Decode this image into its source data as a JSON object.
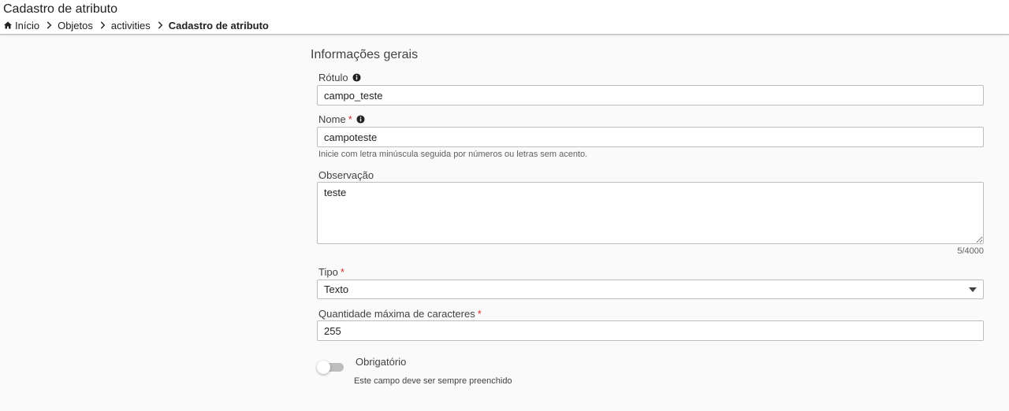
{
  "header": {
    "title": "Cadastro de atributo",
    "breadcrumb": [
      {
        "label": "Início",
        "icon": "home-icon"
      },
      {
        "label": "Objetos"
      },
      {
        "label": "activities"
      },
      {
        "label": "Cadastro de atributo"
      }
    ]
  },
  "form": {
    "section_title": "Informações gerais",
    "rotulo": {
      "label": "Rótulo",
      "value": "campo_teste"
    },
    "nome": {
      "label": "Nome",
      "required_mark": "*",
      "value": "campoteste",
      "hint": "Inicie com letra minúscula seguida por números ou letras sem acento."
    },
    "observacao": {
      "label": "Observação",
      "value": "teste",
      "counter": "5/4000"
    },
    "tipo": {
      "label": "Tipo",
      "required_mark": "*",
      "value": "Texto"
    },
    "quantidade": {
      "label": "Quantidade máxima de caracteres",
      "required_mark": "*",
      "value": "255"
    },
    "obrigatorio": {
      "label": "Obrigatório",
      "hint": "Este campo deve ser sempre preenchido",
      "checked": false
    }
  },
  "colors": {
    "required": "#d32f2f",
    "border": "#bdbdbd",
    "background": "#fafafa"
  }
}
